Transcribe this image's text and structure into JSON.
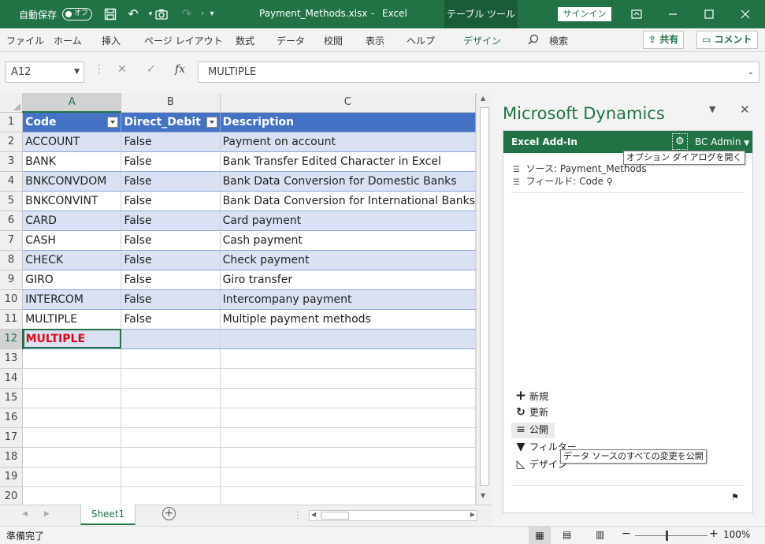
{
  "titlebar": {
    "autosave_label": "自動保存",
    "autosave_state": "オフ",
    "filename": "Payment_Methods.xlsx",
    "separator": "-",
    "app": "Excel",
    "context_tab": "テーブル ツール",
    "signin": "サインイン"
  },
  "ribbon": {
    "tabs": [
      "ファイル",
      "ホーム",
      "挿入",
      "ページ レイアウト",
      "数式",
      "データ",
      "校閲",
      "表示",
      "ヘルプ",
      "デザイン"
    ],
    "search": "検索",
    "share": "共有",
    "comment": "コメント"
  },
  "formula_bar": {
    "name_box": "A12",
    "fx": "fx",
    "value": "MULTIPLE"
  },
  "grid": {
    "columns": [
      "A",
      "B",
      "C"
    ],
    "header": [
      "Code",
      "Direct_Debit",
      "Description"
    ],
    "rows": [
      [
        "ACCOUNT",
        "False",
        "Payment on account"
      ],
      [
        "BANK",
        "False",
        "Bank Transfer Edited Character in Excel"
      ],
      [
        "BNKCONVDOM",
        "False",
        "Bank Data Conversion for Domestic Banks"
      ],
      [
        "BNKCONVINT",
        "False",
        "Bank Data Conversion for International Banks"
      ],
      [
        "CARD",
        "False",
        "Card payment"
      ],
      [
        "CASH",
        "False",
        "Cash payment"
      ],
      [
        "CHECK",
        "False",
        "Check payment"
      ],
      [
        "GIRO",
        "False",
        "Giro transfer"
      ],
      [
        "INTERCOM",
        "False",
        "Intercompany payment"
      ],
      [
        "MULTIPLE",
        "False",
        "Multiple payment methods"
      ]
    ],
    "new_row": [
      "MULTIPLE",
      "",
      ""
    ],
    "row_numbers": [
      "1",
      "2",
      "3",
      "4",
      "5",
      "6",
      "7",
      "8",
      "9",
      "10",
      "11",
      "12",
      "13",
      "14",
      "15",
      "16",
      "17",
      "18",
      "19",
      "20"
    ]
  },
  "sheets": {
    "active": "Sheet1"
  },
  "status": {
    "ready": "準備完了",
    "zoom": "100%"
  },
  "pane": {
    "title": "Microsoft Dynamics",
    "addin_label": "Excel Add-In",
    "user": "BC Admin",
    "options_tooltip": "オプション ダイアログを開く",
    "source": "ソース: Payment_Methods",
    "field": "フィールド: Code",
    "actions": [
      "新規",
      "更新",
      "公開",
      "フィルター",
      "デザイン"
    ],
    "publish_tooltip": "データ ソースのすべての変更を公開"
  }
}
